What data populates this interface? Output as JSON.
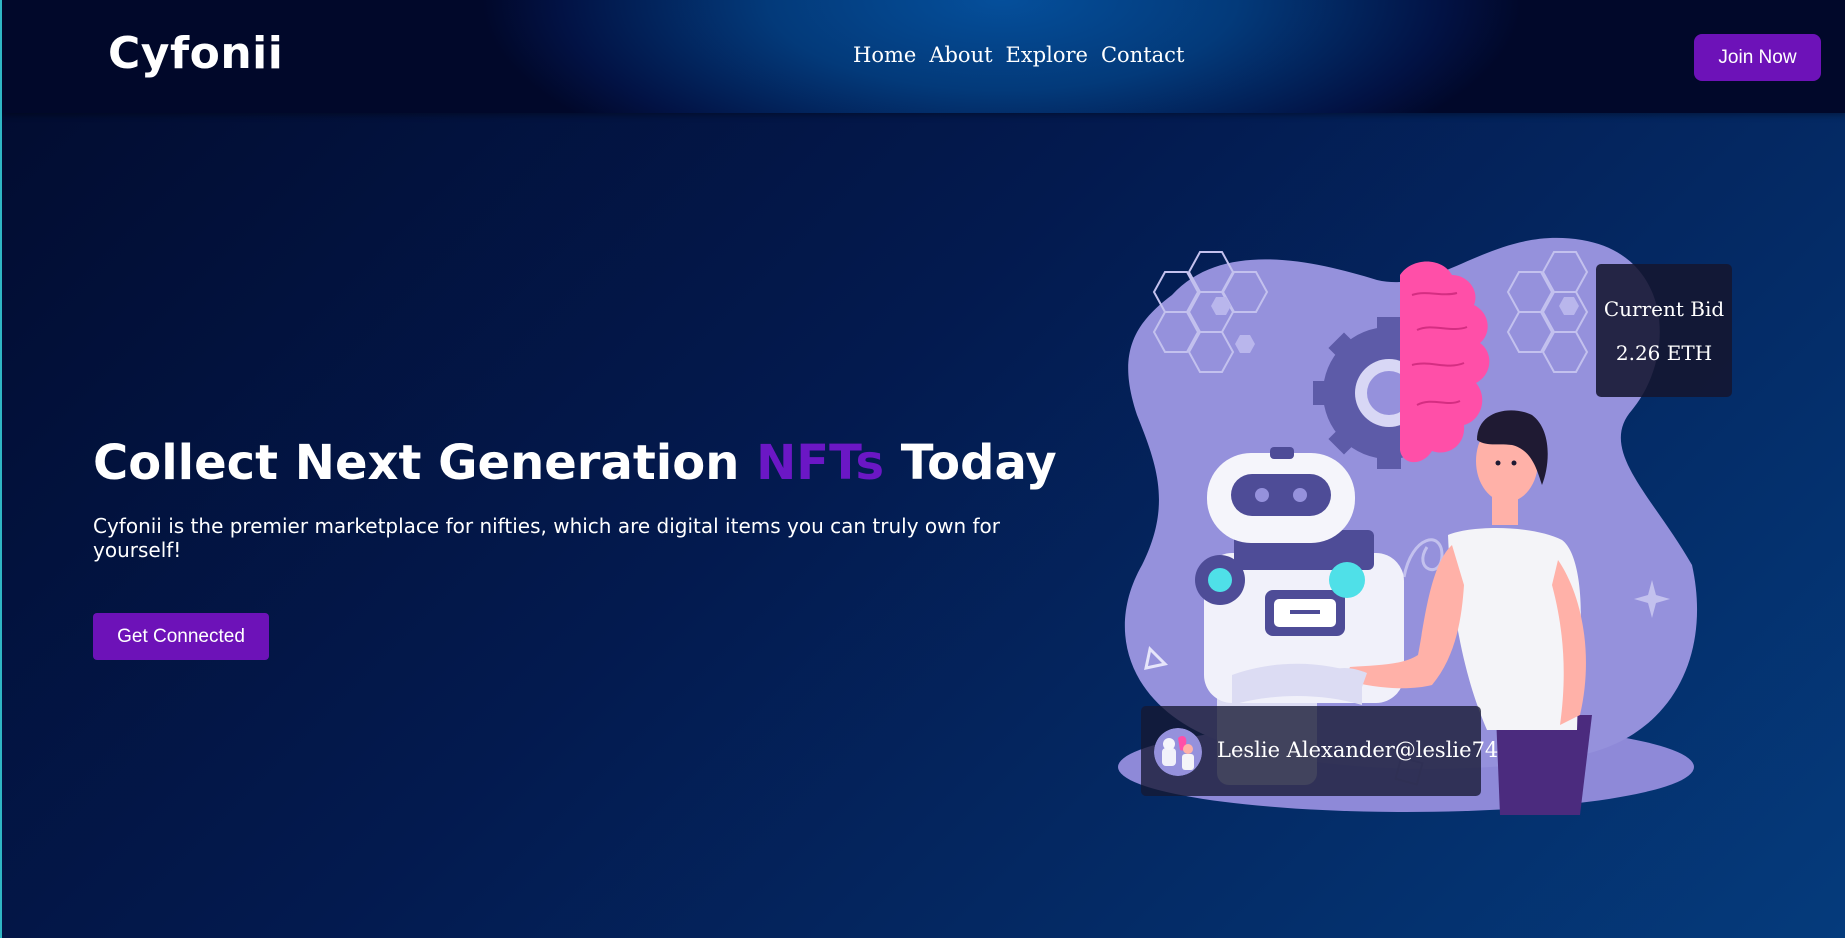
{
  "header": {
    "logo": "Cyfonii",
    "nav": [
      "Home",
      "About",
      "Explore",
      "Contact"
    ],
    "join_label": "Join Now"
  },
  "hero": {
    "title_part1": "Collect Next Generation ",
    "title_accent": "NFTs",
    "title_part2": " Today",
    "description": "Cyfonii is the premier marketplace for nifties, which are digital items you can truly own for yourself!",
    "cta_label": "Get Connected"
  },
  "bid_card": {
    "label": "Current Bid",
    "value": "2.26 ETH"
  },
  "creator_card": {
    "name": "Leslie Alexander@leslie74"
  },
  "colors": {
    "accent": "#6d12b8",
    "accent_text": "#6b17c5",
    "blob": "#9591dc",
    "brain": "#ff4fa8"
  }
}
